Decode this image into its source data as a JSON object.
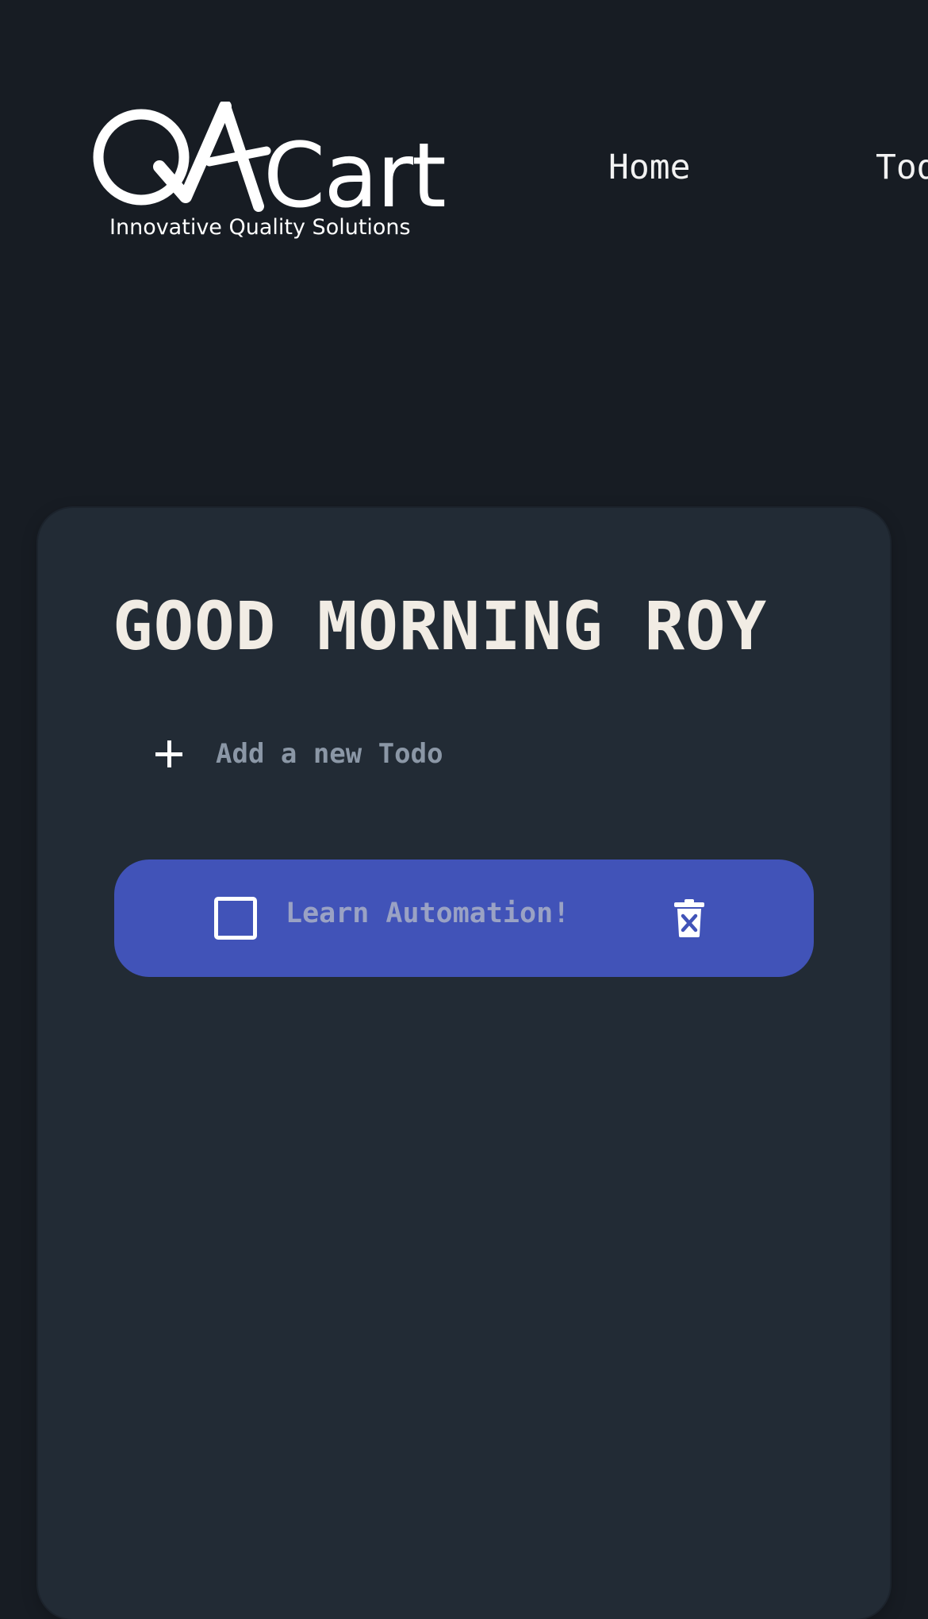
{
  "brand": {
    "logo_text": "QACart",
    "tagline": "Innovative Quality Solutions"
  },
  "nav": {
    "items": [
      {
        "label": "Home"
      },
      {
        "label": "Todo"
      }
    ]
  },
  "main": {
    "greeting": "GOOD MORNING ROY",
    "new_todo_placeholder": "Add a new Todo",
    "new_todo_value": "",
    "todos": [
      {
        "text": "Learn Automation!",
        "completed": false
      }
    ]
  },
  "icons": {
    "add": "plus-icon",
    "checkbox": "checkbox-icon",
    "delete": "trash-icon"
  },
  "colors": {
    "page_background": "#171c23",
    "card_background": "#222b35",
    "todo_background": "#4153b8",
    "greeting_text": "#f1ece4",
    "muted_text": "#8b97a6"
  }
}
